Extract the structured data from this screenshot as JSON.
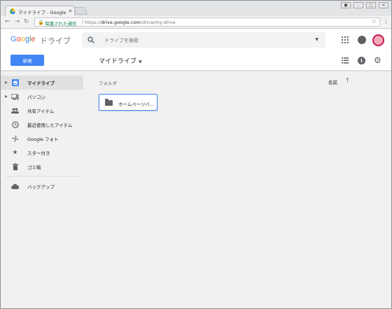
{
  "browser": {
    "tab_title": "マイドライブ - Google",
    "tab_close": "×",
    "secure_label": "保護された通信",
    "url_prefix": "https://",
    "url_host": "drive.google.com",
    "url_path": "/drive/my-drive"
  },
  "header": {
    "logo_parts": [
      "G",
      "o",
      "o",
      "g",
      "l",
      "e"
    ],
    "product_name": "ドライブ",
    "search_placeholder": "ドライブを検索"
  },
  "toolbar": {
    "new_label": "新規",
    "breadcrumb": "マイドライブ"
  },
  "sidebar": {
    "items": [
      {
        "label": "マイドライブ",
        "icon": "drive-icon"
      },
      {
        "label": "パソコン",
        "icon": "computer-icon"
      },
      {
        "label": "共有アイテム",
        "icon": "people-icon"
      },
      {
        "label": "最近使用したアイテム",
        "icon": "clock-icon"
      },
      {
        "label": "Google フォト",
        "icon": "pinwheel-icon"
      },
      {
        "label": "スター付き",
        "icon": "star-icon"
      },
      {
        "label": "ゴミ箱",
        "icon": "trash-icon"
      },
      {
        "label": "バックアップ",
        "icon": "cloud-icon"
      }
    ]
  },
  "main": {
    "section_label": "フォルダ",
    "sort_label": "名前",
    "folders": [
      {
        "name": "ホームページバ..."
      }
    ]
  },
  "colors": {
    "accent": "#4285f4"
  }
}
